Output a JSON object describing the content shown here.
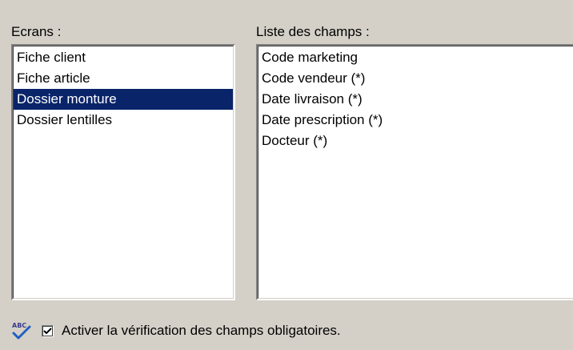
{
  "screens": {
    "label": "Ecrans :",
    "items": [
      {
        "label": "Fiche client",
        "selected": false
      },
      {
        "label": "Fiche article",
        "selected": false
      },
      {
        "label": "Dossier monture",
        "selected": true
      },
      {
        "label": "Dossier lentilles",
        "selected": false
      }
    ]
  },
  "fields": {
    "label": "Liste des champs :",
    "items": [
      {
        "label": "Code marketing"
      },
      {
        "label": "Code vendeur (*)"
      },
      {
        "label": "Date livraison (*)"
      },
      {
        "label": "Date prescription (*)"
      },
      {
        "label": "Docteur (*)"
      }
    ]
  },
  "options": {
    "check_label": "Activer la vérification des champs obligatoires.",
    "checked": true,
    "icon": "spellcheck-icon"
  },
  "colors": {
    "window_bg": "#d4d0c8",
    "selection_bg": "#0a246a",
    "selection_text": "#ffffff"
  }
}
